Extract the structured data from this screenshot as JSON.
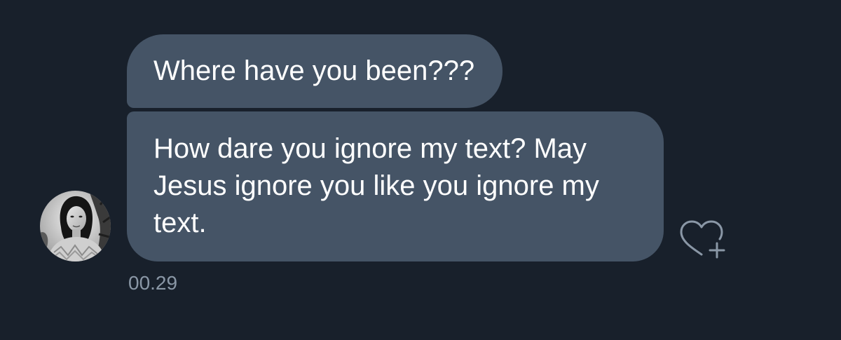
{
  "thread": {
    "messages": [
      {
        "text": "Where have you been???"
      },
      {
        "text": "How dare you ignore my text? May Jesus ignore you like you ignore my text."
      }
    ],
    "timestamp": "00.29"
  },
  "avatar": {
    "style": "grayscale-portrait"
  },
  "reaction": {
    "icon": "heart-plus-icon"
  },
  "colors": {
    "background": "#18202b",
    "bubble": "#455466",
    "text": "#ffffff",
    "muted": "#8a97a6"
  }
}
